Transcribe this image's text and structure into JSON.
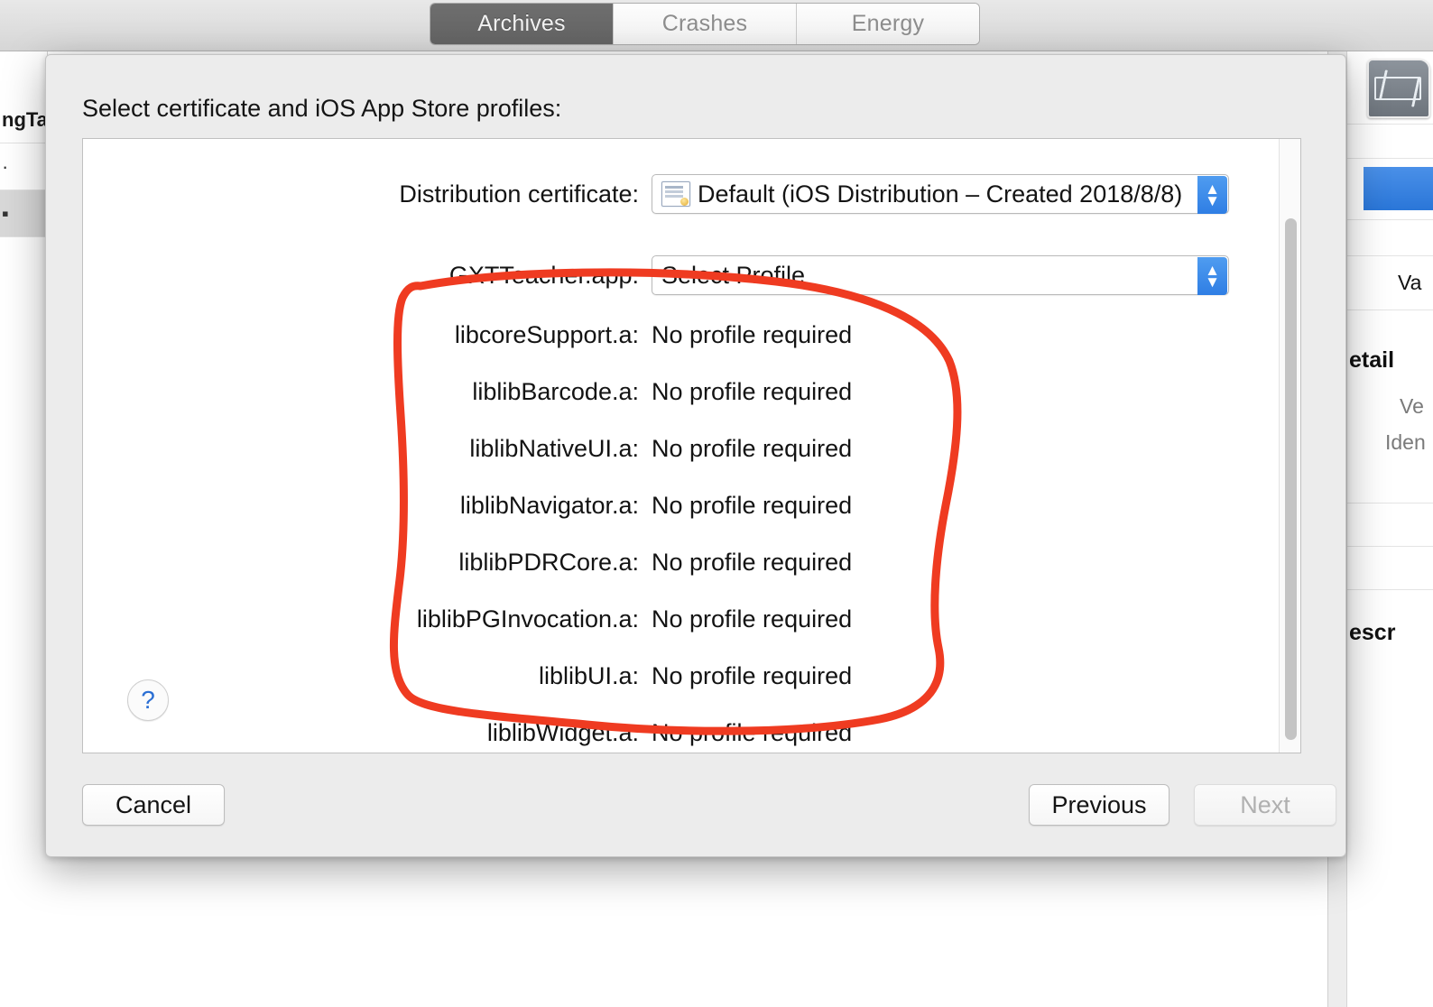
{
  "background": {
    "tabs": [
      {
        "label": "Archives",
        "active": true
      },
      {
        "label": "Crashes",
        "active": false
      },
      {
        "label": "Energy",
        "active": false
      }
    ],
    "left_list_partial": {
      "row_a": "ngTa",
      "row_b": "·",
      "row_c": "▪"
    },
    "right_inspector": {
      "value_partial": "Va",
      "details_partial": "etail",
      "version_partial": "Ve",
      "identifier_partial": "Iden",
      "description_partial": "escr"
    }
  },
  "sheet": {
    "title": "Select certificate and iOS App Store profiles:",
    "certificate": {
      "label": "Distribution certificate:",
      "selected": "Default (iOS Distribution – Created 2018/8/8)",
      "icon": "certificate-icon"
    },
    "app_profile": {
      "label": "GXTTeacher.app:",
      "selected": "Select Profile"
    },
    "libraries": [
      {
        "label": "libcoreSupport.a:",
        "status": "No profile required"
      },
      {
        "label": "liblibBarcode.a:",
        "status": "No profile required"
      },
      {
        "label": "liblibNativeUI.a:",
        "status": "No profile required"
      },
      {
        "label": "liblibNavigator.a:",
        "status": "No profile required"
      },
      {
        "label": "liblibPDRCore.a:",
        "status": "No profile required"
      },
      {
        "label": "liblibPGInvocation.a:",
        "status": "No profile required"
      },
      {
        "label": "liblibUI.a:",
        "status": "No profile required"
      },
      {
        "label": "liblibWidget.a:",
        "status": "No profile required"
      }
    ],
    "help_label": "?",
    "buttons": {
      "cancel": "Cancel",
      "previous": "Previous",
      "next": "Next"
    }
  },
  "annotation": {
    "type": "hand-drawn-circle",
    "color": "#ef3b21",
    "stroke_width": 9
  },
  "colors": {
    "accent_blue": "#2f7ee4",
    "annotation_red": "#ef3b21",
    "sheet_bg": "#ececec",
    "active_tab_bg": "#686868"
  }
}
